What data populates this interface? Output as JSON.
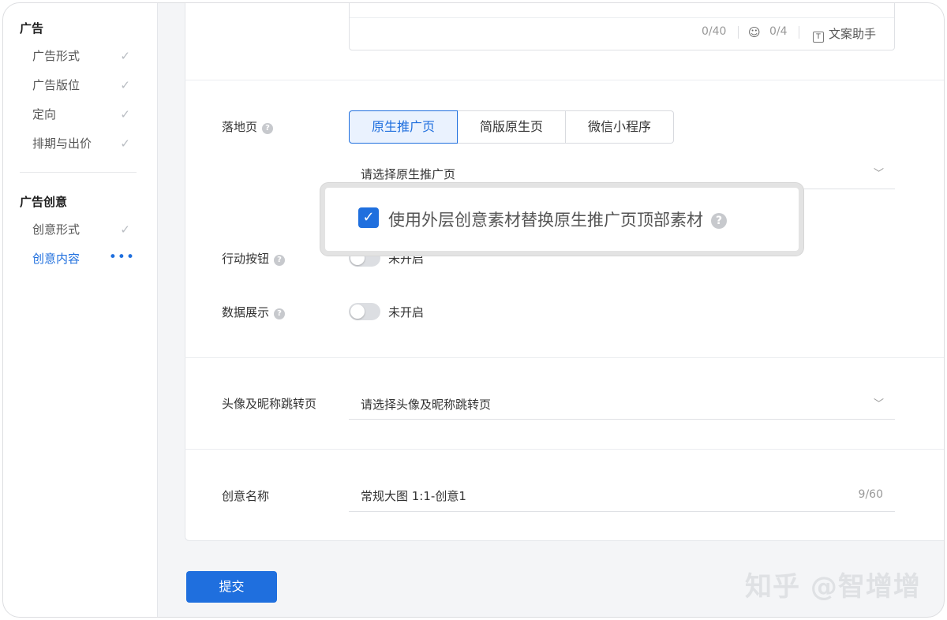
{
  "sidebar": {
    "group1": "广告",
    "items1": [
      {
        "label": "广告形式",
        "status": "done"
      },
      {
        "label": "广告版位",
        "status": "done"
      },
      {
        "label": "定向",
        "status": "done"
      },
      {
        "label": "排期与出价",
        "status": "done"
      }
    ],
    "group2": "广告创意",
    "items2": [
      {
        "label": "创意形式",
        "status": "done"
      },
      {
        "label": "创意内容",
        "status": "in-progress"
      }
    ],
    "check_glyph": "✓",
    "dots_glyph": "•••"
  },
  "copy_box": {
    "char_count": "0/40",
    "emoji_count": "0/4",
    "emoji_icon": "☺",
    "helper_icon": "T",
    "helper_label": "文案助手"
  },
  "landing": {
    "label": "落地页",
    "help": "?",
    "tabs": [
      "原生推广页",
      "简版原生页",
      "微信小程序"
    ],
    "active_tab": 0,
    "select_value": "请选择原生推广页",
    "chevron": "﹀"
  },
  "overlay": {
    "checkbox_checked": true,
    "check_glyph": "✓",
    "text": "使用外层创意素材替换原生推广页顶部素材",
    "help": "?"
  },
  "action_button": {
    "label": "行动按钮",
    "help": "?",
    "enabled": false,
    "state_text": "未开启"
  },
  "data_display": {
    "label": "数据展示",
    "help": "?",
    "enabled": false,
    "state_text": "未开启"
  },
  "avatar_jump": {
    "label": "头像及昵称跳转页",
    "placeholder": "请选择头像及昵称跳转页",
    "chevron": "﹀"
  },
  "creative_name": {
    "label": "创意名称",
    "value": "常规大图 1:1-创意1",
    "count": "9/60"
  },
  "submit_label": "提交",
  "watermark": "知乎 @智增增",
  "colors": {
    "accent": "#1f6fde",
    "toggle_off": "#dcdee2",
    "border": "#dfe1e5"
  }
}
